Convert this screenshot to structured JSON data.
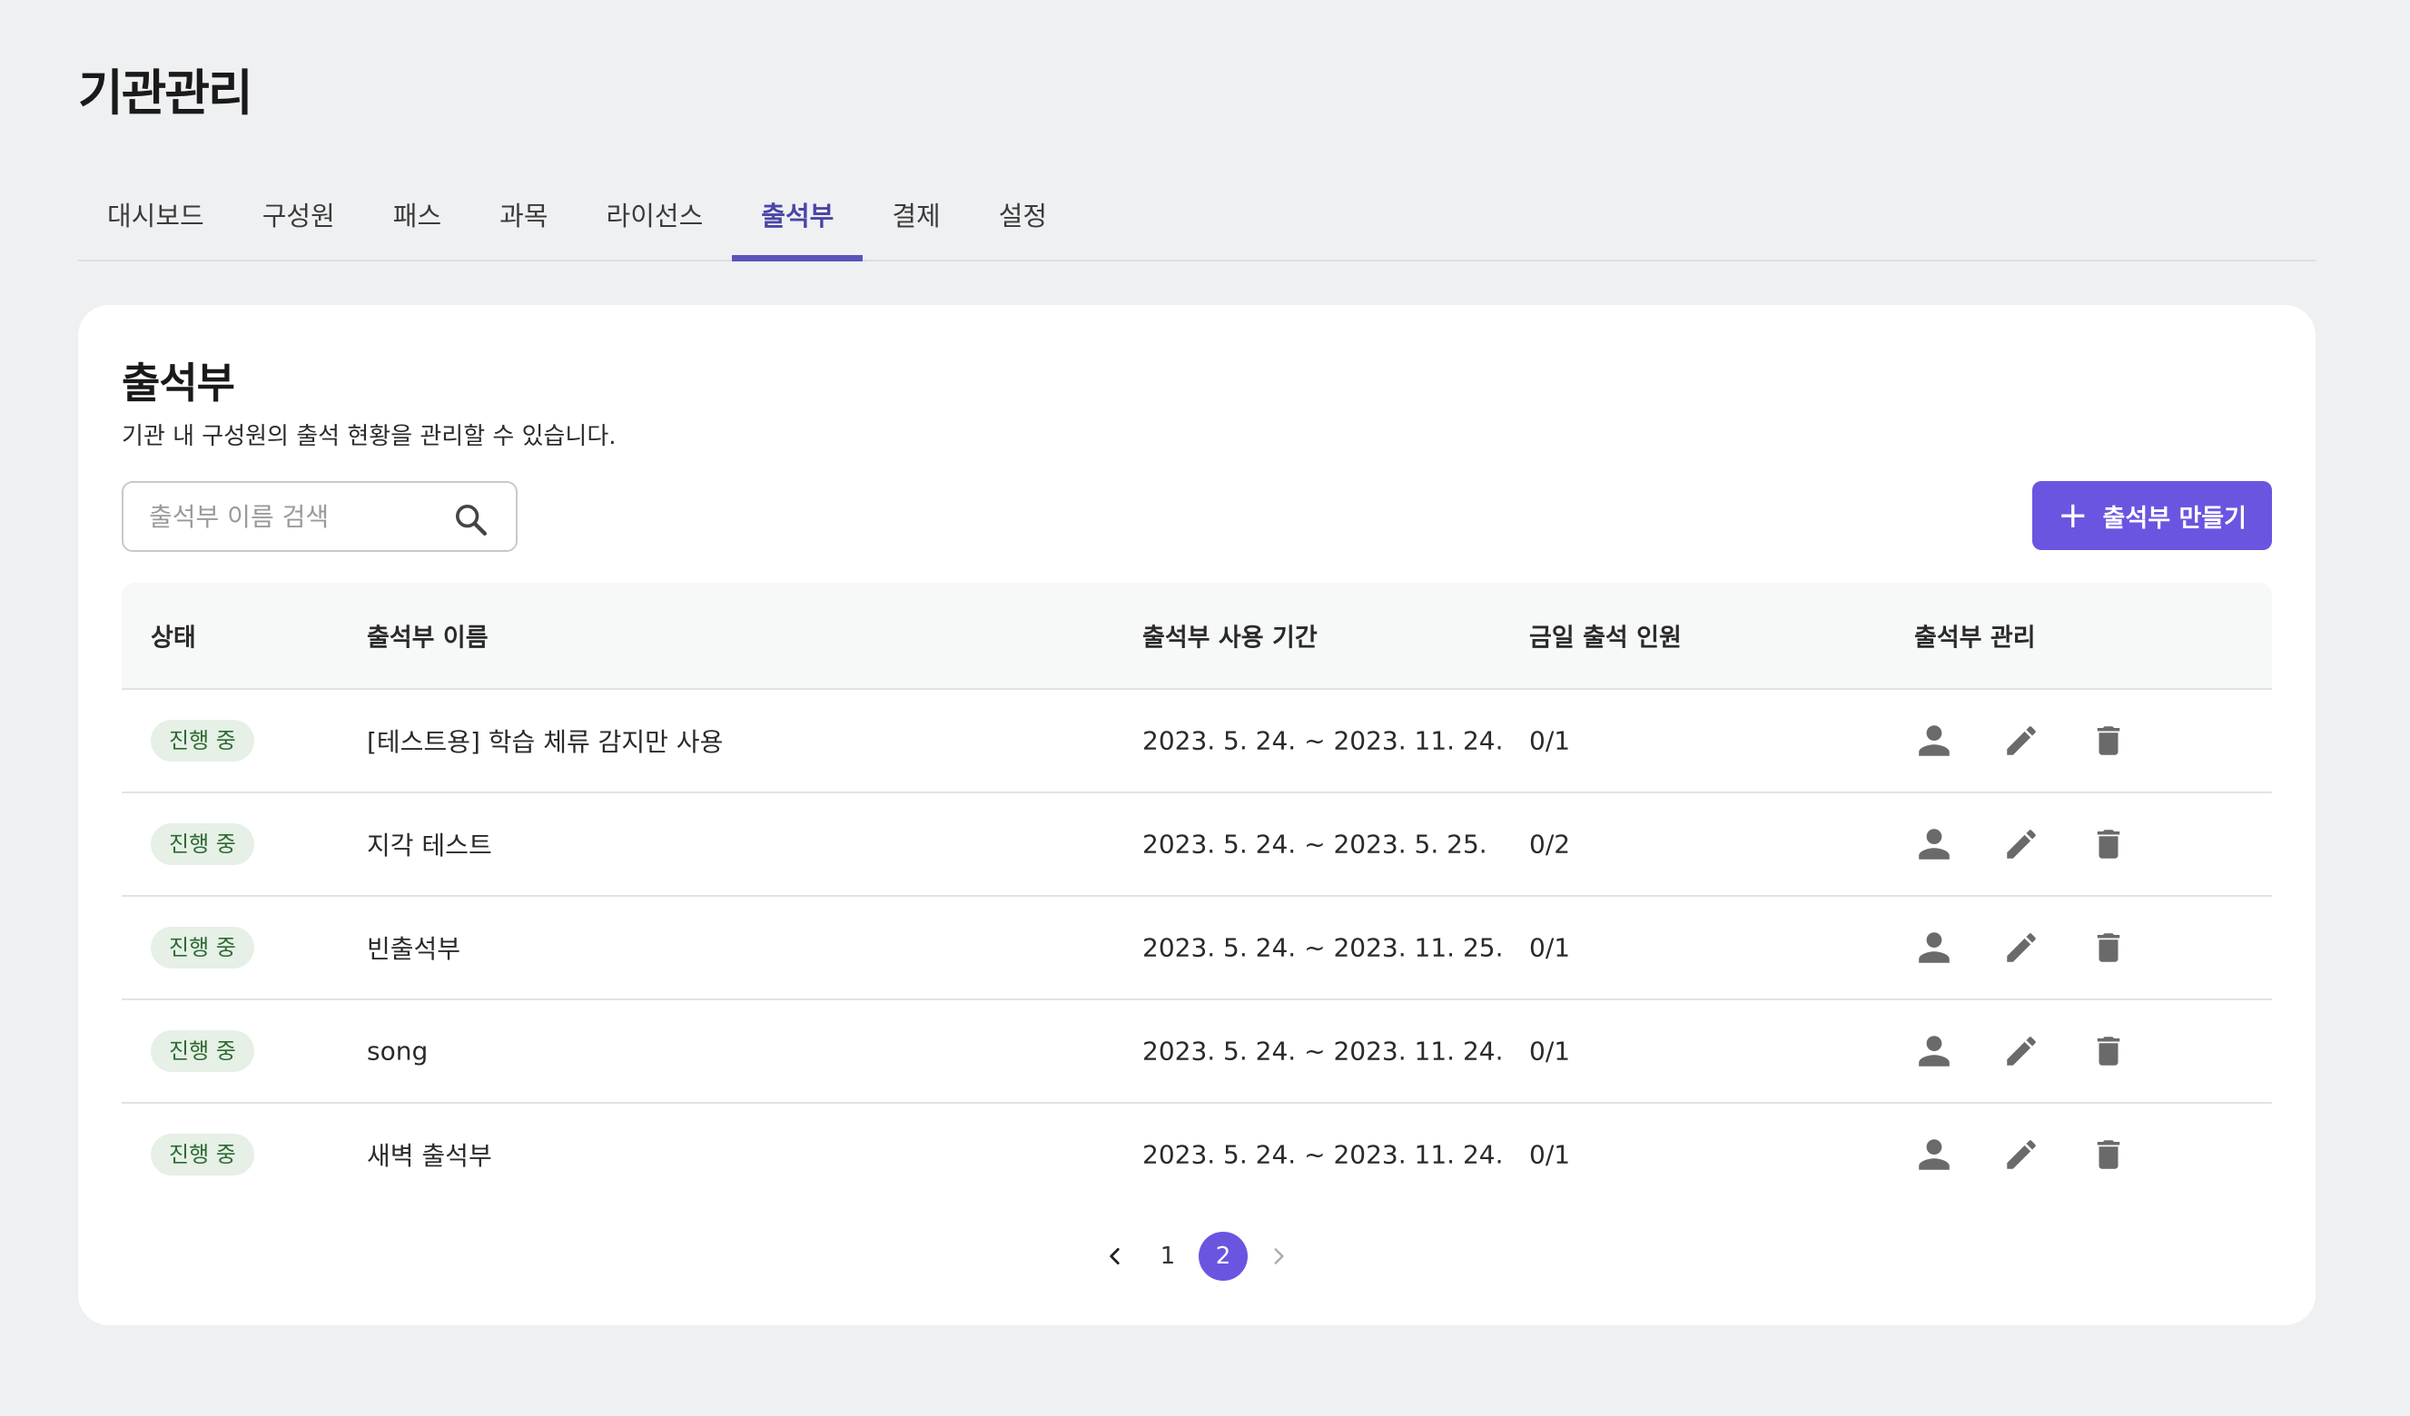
{
  "page": {
    "title": "기관관리"
  },
  "tabs": [
    {
      "label": "대시보드",
      "active": false
    },
    {
      "label": "구성원",
      "active": false
    },
    {
      "label": "패스",
      "active": false
    },
    {
      "label": "과목",
      "active": false
    },
    {
      "label": "라이선스",
      "active": false
    },
    {
      "label": "출석부",
      "active": true
    },
    {
      "label": "결제",
      "active": false
    },
    {
      "label": "설정",
      "active": false
    }
  ],
  "card": {
    "title": "출석부",
    "description": "기관 내 구성원의 출석 현황을 관리할 수 있습니다."
  },
  "search": {
    "placeholder": "출석부 이름 검색",
    "value": "",
    "icon": "search-icon"
  },
  "create_button": {
    "label": "출석부 만들기",
    "icon": "plus-icon"
  },
  "table": {
    "headers": {
      "status": "상태",
      "name": "출석부 이름",
      "period": "출석부 사용 기간",
      "today_count": "금일 출석 인원",
      "manage": "출석부 관리"
    },
    "rows": [
      {
        "status": "진행 중",
        "name": "[테스트용] 학습 체류 감지만 사용",
        "period": "2023. 5. 24. ~ 2023. 11. 24.",
        "today_count": "0/1"
      },
      {
        "status": "진행 중",
        "name": "지각 테스트",
        "period": "2023. 5. 24. ~ 2023. 5. 25.",
        "today_count": "0/2"
      },
      {
        "status": "진행 중",
        "name": "빈출석부",
        "period": "2023. 5. 24. ~ 2023. 11. 25.",
        "today_count": "0/1"
      },
      {
        "status": "진행 중",
        "name": "song",
        "period": "2023. 5. 24. ~ 2023. 11. 24.",
        "today_count": "0/1"
      },
      {
        "status": "진행 중",
        "name": "새벽 출석부",
        "period": "2023. 5. 24. ~ 2023. 11. 24.",
        "today_count": "0/1"
      }
    ],
    "row_actions": [
      "person-icon",
      "pencil-icon",
      "trash-icon"
    ]
  },
  "pagination": {
    "pages": [
      "1",
      "2"
    ],
    "current": "2"
  },
  "colors": {
    "accent": "#6a55e0",
    "tab_active": "#4a45a8",
    "badge_bg": "#e6f0e6",
    "badge_text": "#2d6a33",
    "background": "#eff0f2"
  }
}
